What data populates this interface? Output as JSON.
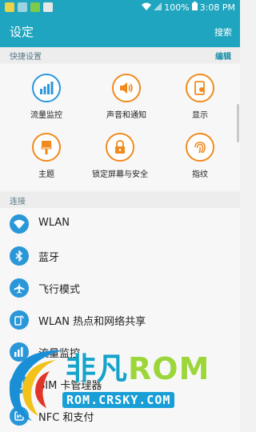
{
  "status_bar": {
    "battery": "100%",
    "time": "3:08 PM"
  },
  "app_bar": {
    "title": "设定",
    "search_label": "搜索"
  },
  "quick_settings": {
    "title": "快捷设置",
    "edit_label": "编辑",
    "items": [
      {
        "label": "流量监控",
        "icon": "data-usage-icon",
        "color": "#2a97d9"
      },
      {
        "label": "声音和通知",
        "icon": "speaker-icon",
        "color": "#f08a1c"
      },
      {
        "label": "显示",
        "icon": "display-icon",
        "color": "#f08a1c"
      },
      {
        "label": "主题",
        "icon": "paintbrush-icon",
        "color": "#f08a1c"
      },
      {
        "label": "锁定屏幕与安全",
        "icon": "lock-icon",
        "color": "#f08a1c"
      },
      {
        "label": "指纹",
        "icon": "fingerprint-icon",
        "color": "#f08a1c"
      }
    ]
  },
  "connections": {
    "title": "连接",
    "items": [
      {
        "label": "WLAN",
        "icon": "wifi-icon"
      },
      {
        "label": "蓝牙",
        "icon": "bluetooth-icon"
      },
      {
        "label": "飞行模式",
        "icon": "airplane-icon"
      },
      {
        "label": "WLAN 热点和网络共享",
        "icon": "hotspot-icon"
      },
      {
        "label": "流量监控",
        "icon": "data-usage-icon"
      },
      {
        "label": "SIM 卡管理器",
        "icon": "sim-card-icon"
      },
      {
        "label": "NFC 和支付",
        "icon": "nfc-icon"
      }
    ]
  },
  "watermark": {
    "brand_part1": "非凡",
    "brand_part2": "ROM",
    "url": "ROM.CRSKY.COM"
  }
}
